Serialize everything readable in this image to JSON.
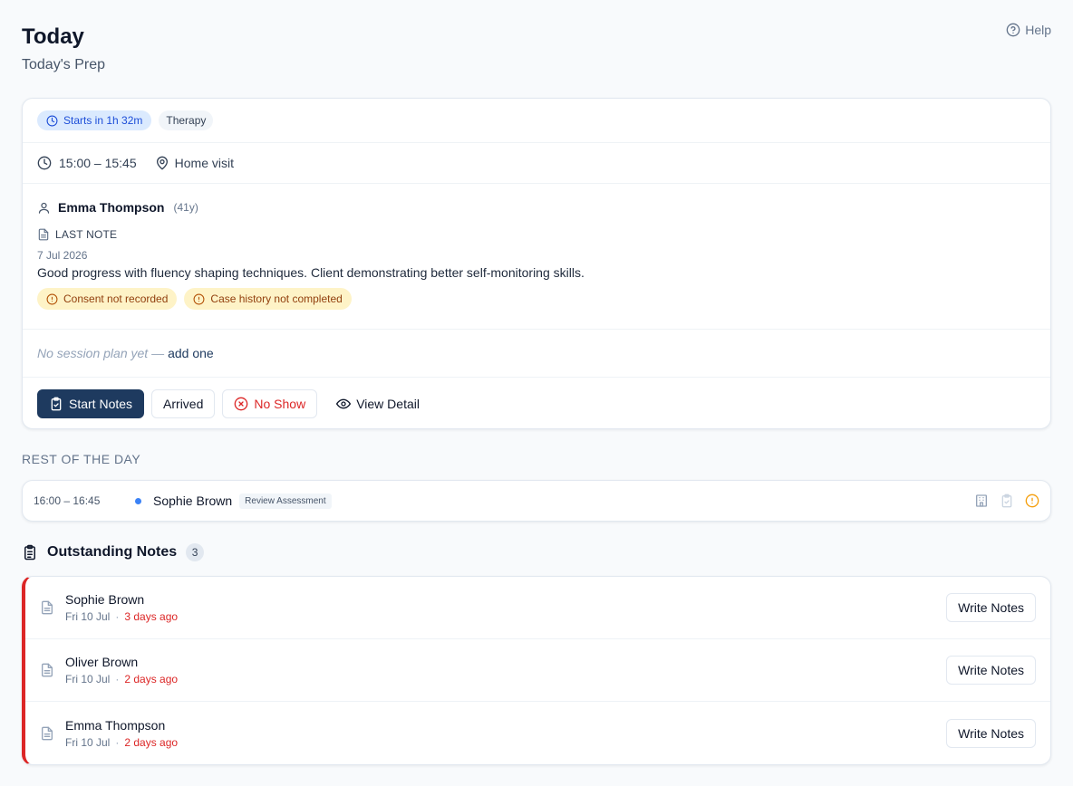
{
  "header": {
    "title": "Today",
    "subtitle": "Today's Prep",
    "help_label": "Help"
  },
  "session": {
    "starts_in": "Starts in 1h 32m",
    "type": "Therapy",
    "time_range": "15:00 – 15:45",
    "location": "Home visit",
    "client_name": "Emma Thompson",
    "client_age": "(41y)",
    "last_note_label": "LAST NOTE",
    "last_note_date": "7 Jul 2026",
    "last_note_text": "Good progress with fluency shaping techniques. Client demonstrating better self-monitoring skills.",
    "warnings": [
      "Consent not recorded",
      "Case history not completed"
    ],
    "plan_text": "No session plan yet —",
    "plan_link": "add one",
    "actions": {
      "start_notes": "Start Notes",
      "arrived": "Arrived",
      "no_show": "No Show",
      "view_detail": "View Detail"
    }
  },
  "rest_of_day": {
    "label": "REST OF THE DAY",
    "items": [
      {
        "time": "16:00 – 16:45",
        "name": "Sophie Brown",
        "tag": "Review Assessment"
      }
    ]
  },
  "outstanding": {
    "title": "Outstanding Notes",
    "count": "3",
    "button_label": "Write Notes",
    "items": [
      {
        "name": "Sophie Brown",
        "date": "Fri 10 Jul",
        "ago": "3 days ago"
      },
      {
        "name": "Oliver Brown",
        "date": "Fri 10 Jul",
        "ago": "2 days ago"
      },
      {
        "name": "Emma Thompson",
        "date": "Fri 10 Jul",
        "ago": "2 days ago"
      }
    ]
  },
  "colors": {
    "primary": "#1e3a5f",
    "danger": "#dc2626",
    "warning_bg": "#fef3c7",
    "warning_text": "#92400e",
    "info_bg": "#dbeafe",
    "info_text": "#1d4ed8",
    "dot_blue": "#3b82f6"
  }
}
